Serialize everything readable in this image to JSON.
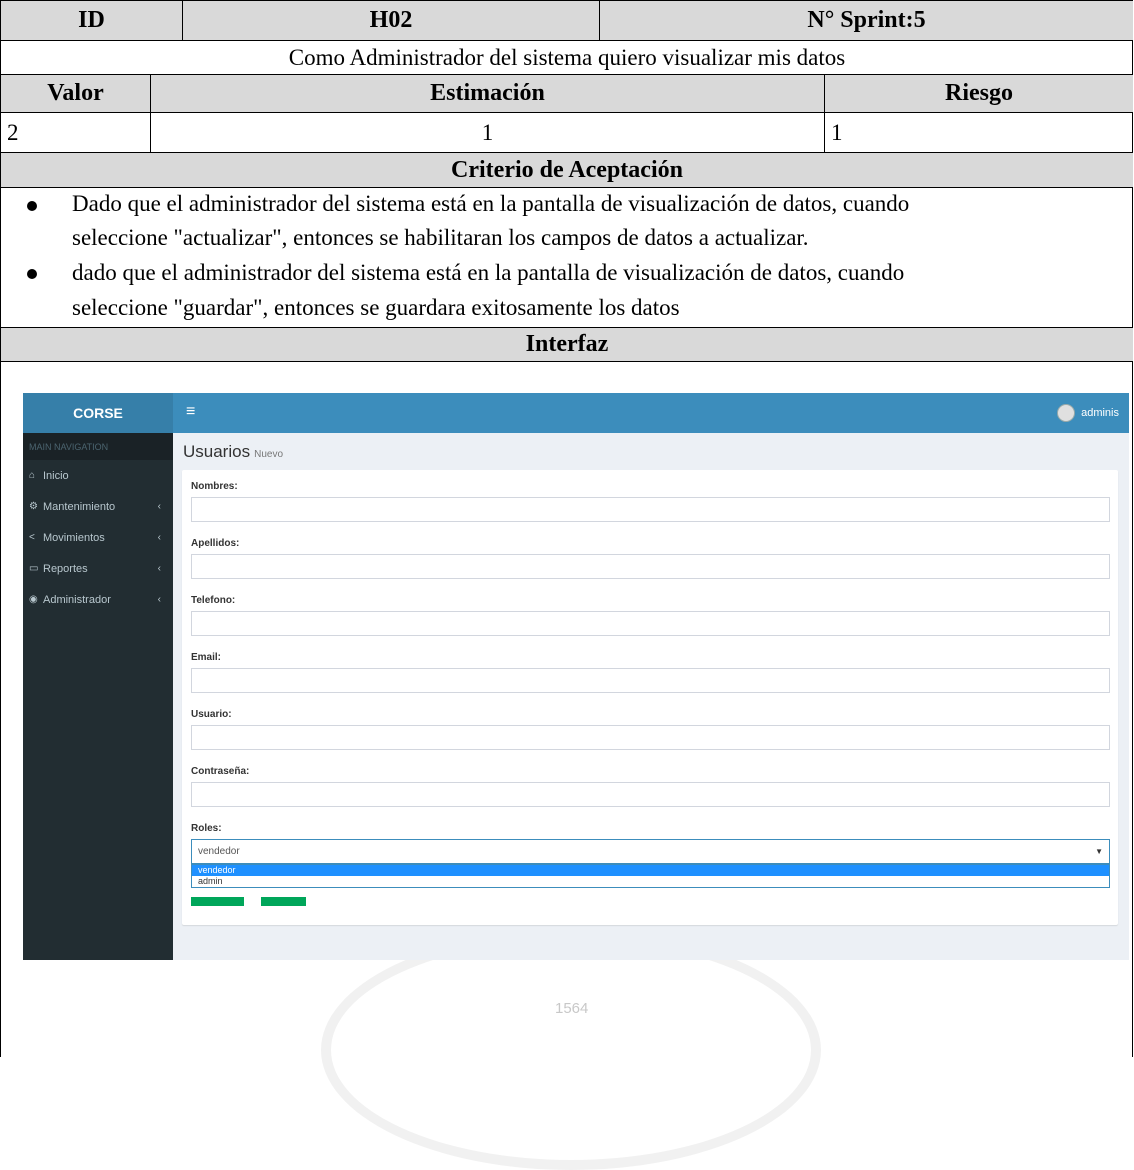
{
  "table": {
    "id_label": "ID",
    "id_value": "H02",
    "sprint": "N° Sprint:5",
    "story": "Como Administrador del sistema quiero visualizar mis datos",
    "valor_label": "Valor",
    "estimacion_label": "Estimación",
    "riesgo_label": "Riesgo",
    "valor": "2",
    "estimacion": "1",
    "riesgo": "1",
    "criterio_label": "Criterio de Aceptación",
    "criteria": [
      {
        "line1": "Dado que el administrador del sistema está en la pantalla de visualización de datos, cuando",
        "line2": "seleccione \"actualizar\", entonces se habilitaran los campos de datos a actualizar."
      },
      {
        "line1": " dado que el administrador del sistema está en la pantalla de visualización de datos, cuando",
        "line2": "seleccione \"guardar\", entonces se guardara exitosamente los datos"
      }
    ],
    "interfaz_label": "Interfaz"
  },
  "app": {
    "brand": "CORSE",
    "hamburger": "≡",
    "user": "adminis",
    "nav_header": "MAIN NAVIGATION",
    "nav": [
      {
        "icon": "home-icon",
        "glyph": "⌂",
        "label": "Inicio",
        "chevron": ""
      },
      {
        "icon": "cogs-icon",
        "glyph": "⚙",
        "label": "Mantenimiento",
        "chevron": "‹"
      },
      {
        "icon": "share-icon",
        "glyph": "<",
        "label": "Movimientos",
        "chevron": "‹"
      },
      {
        "icon": "print-icon",
        "glyph": "▭",
        "label": "Reportes",
        "chevron": "‹"
      },
      {
        "icon": "user-circle-icon",
        "glyph": "◉",
        "label": "Administrador",
        "chevron": "‹"
      }
    ],
    "page_title": "Usuarios",
    "page_subtitle": "Nuevo",
    "fields": {
      "nombres": "Nombres:",
      "apellidos": "Apellidos:",
      "telefono": "Telefono:",
      "email": "Email:",
      "usuario": "Usuario:",
      "contrasena": "Contraseña:",
      "roles": "Roles:"
    },
    "roles_selected": "vendedor",
    "roles_options": [
      "vendedor",
      "admin"
    ]
  },
  "watermark": "1564"
}
